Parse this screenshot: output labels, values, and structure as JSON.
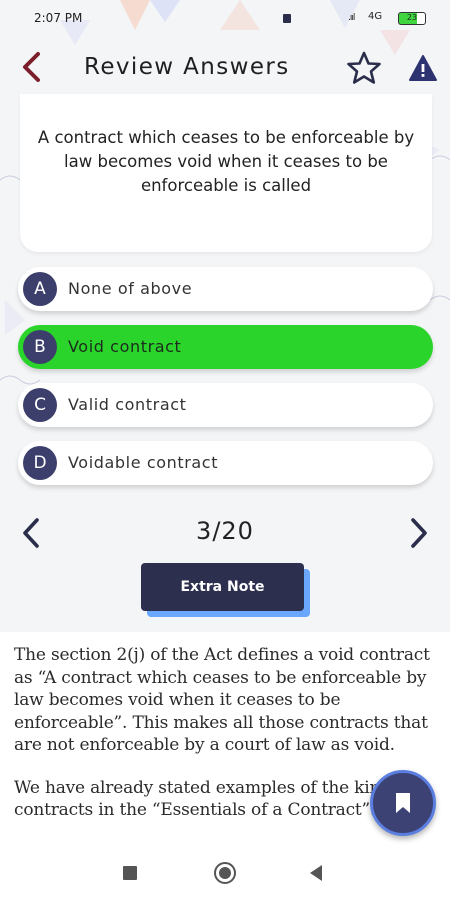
{
  "status_bar": {
    "time": "2:07 PM",
    "signal": ".ııl",
    "network": "4G",
    "battery": "23"
  },
  "header": {
    "title": "Review Answers",
    "back_icon": "chevron-left-icon",
    "favorite_icon": "star-outline-icon",
    "report_icon": "warning-triangle-icon",
    "back_color": "#7a1f2b"
  },
  "question": {
    "text": "A contract which ceases to be enforceable by law becomes void when it ceases to be enforceable is called"
  },
  "options": [
    {
      "letter": "A",
      "text": "None of above",
      "correct": false
    },
    {
      "letter": "B",
      "text": "Void contract",
      "correct": true
    },
    {
      "letter": "C",
      "text": "Valid contract",
      "correct": false
    },
    {
      "letter": "D",
      "text": "Voidable contract",
      "correct": false
    }
  ],
  "pagination": {
    "current": "3/20",
    "prev_icon": "chevron-left-icon",
    "next_icon": "chevron-right-icon"
  },
  "extra_note": {
    "label": "Extra Note"
  },
  "explanation": {
    "paragraph1": "The section 2(j) of the Act defines a void contract as “A contract which ceases to be enforceable by law becomes void when it ceases to be enforceable”. This makes all those contracts that are not enforceable by a court of law as void.",
    "paragraph2": "We have already stated examples of the kinds of contracts in the “Essentials of a Contract”..."
  },
  "fab": {
    "icon": "bookmark-icon"
  },
  "colors": {
    "correct_green": "#2ad42a",
    "letter_circle": "#3c3f6b",
    "button_dark": "#2d2f4f",
    "button_shadow_blue": "#6aa8ff"
  }
}
